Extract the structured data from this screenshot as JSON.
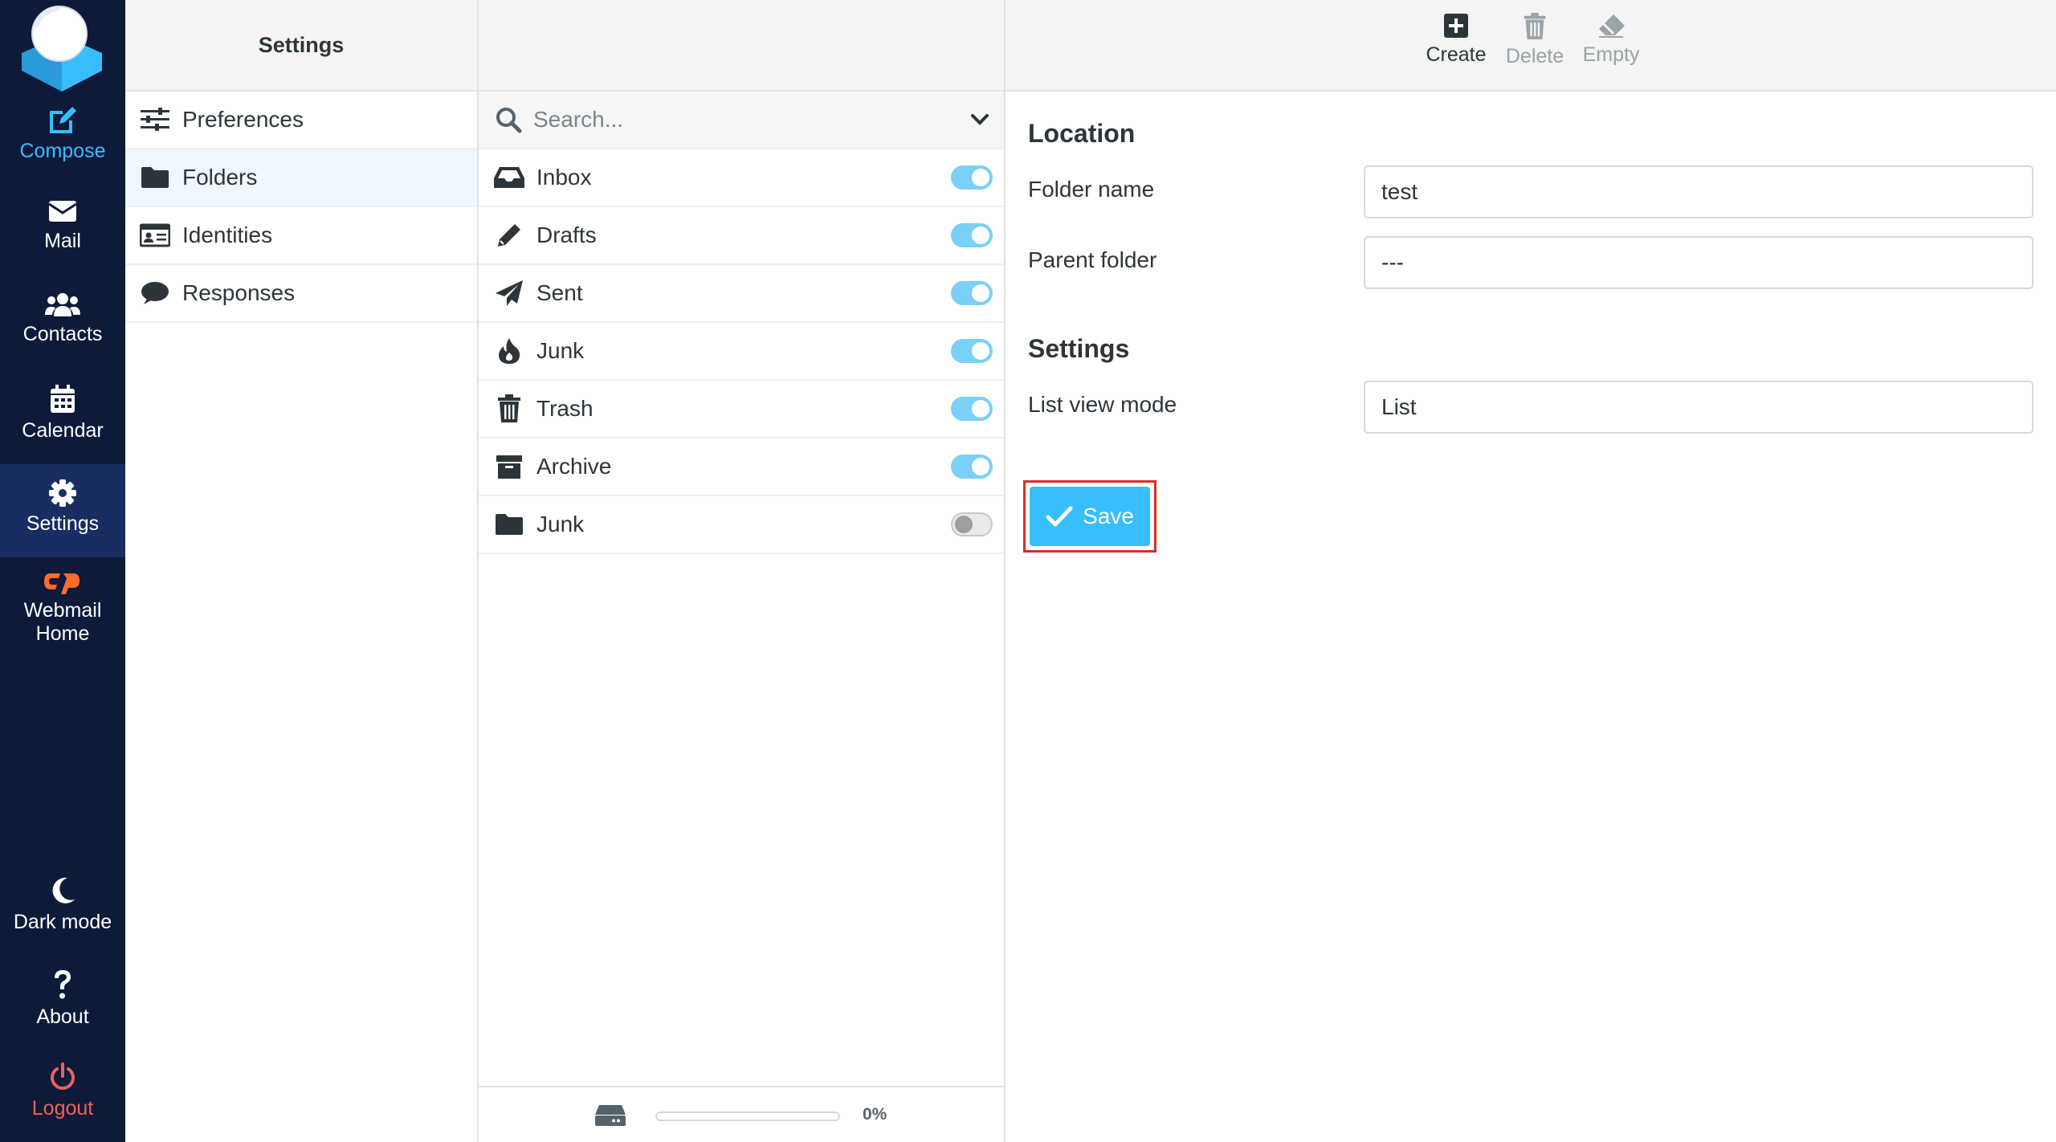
{
  "nav": {
    "compose": "Compose",
    "mail": "Mail",
    "contacts": "Contacts",
    "calendar": "Calendar",
    "settings": "Settings",
    "webmail_home_line1": "Webmail",
    "webmail_home_line2": "Home",
    "dark_mode": "Dark mode",
    "about": "About",
    "logout": "Logout"
  },
  "settings_panel": {
    "title": "Settings",
    "items": [
      {
        "label": "Preferences",
        "icon": "sliders-icon"
      },
      {
        "label": "Folders",
        "icon": "folder-icon"
      },
      {
        "label": "Identities",
        "icon": "id-card-icon"
      },
      {
        "label": "Responses",
        "icon": "comment-icon"
      }
    ],
    "selected": "Folders"
  },
  "folder_panel": {
    "search_placeholder": "Search...",
    "folders": [
      {
        "name": "Inbox",
        "icon": "inbox-icon",
        "subscribed": true
      },
      {
        "name": "Drafts",
        "icon": "pencil-icon",
        "subscribed": true
      },
      {
        "name": "Sent",
        "icon": "paper-plane-icon",
        "subscribed": true
      },
      {
        "name": "Junk",
        "icon": "fire-icon",
        "subscribed": true
      },
      {
        "name": "Trash",
        "icon": "trash-icon",
        "subscribed": true
      },
      {
        "name": "Archive",
        "icon": "archive-icon",
        "subscribed": true
      },
      {
        "name": "Junk",
        "icon": "folder-icon",
        "subscribed": false
      }
    ],
    "quota_percent_label": "0%",
    "quota_fraction": 0
  },
  "toolbar": {
    "create": "Create",
    "delete": "Delete",
    "empty": "Empty"
  },
  "form": {
    "location_title": "Location",
    "folder_name_label": "Folder name",
    "folder_name_value": "test",
    "parent_folder_label": "Parent folder",
    "parent_folder_value": "---",
    "settings_title": "Settings",
    "list_view_mode_label": "List view mode",
    "list_view_mode_value": "List",
    "save_label": "Save"
  },
  "colors": {
    "nav_bg": "#0d1a3a",
    "accent": "#37beff",
    "logout": "#f0605a",
    "highlight_border": "#d9302a"
  }
}
